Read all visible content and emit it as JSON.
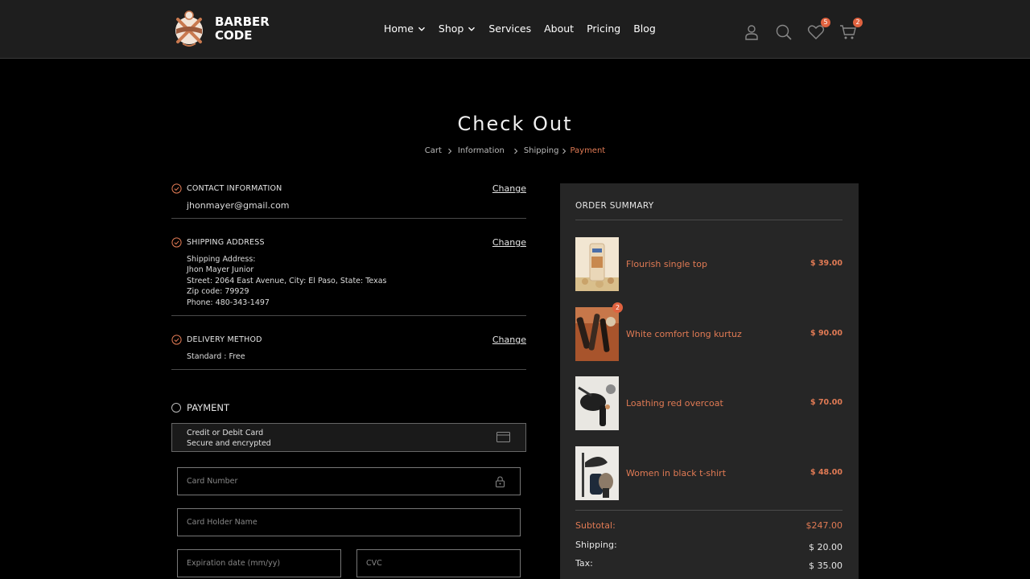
{
  "brand": {
    "line1": "BARBER",
    "line2": "CODE"
  },
  "nav": [
    {
      "label": "Home",
      "dropdown": true
    },
    {
      "label": "Shop",
      "dropdown": true
    },
    {
      "label": "Services",
      "dropdown": false
    },
    {
      "label": "About",
      "dropdown": false
    },
    {
      "label": "Pricing",
      "dropdown": false
    },
    {
      "label": "Blog",
      "dropdown": false
    }
  ],
  "header_icons": {
    "account": "user-icon",
    "search": "search-icon",
    "wishlist": "heart-icon",
    "wishlist_count": "5",
    "cart": "cart-icon",
    "cart_count": "2"
  },
  "page": {
    "title": "Check Out",
    "breadcrumb": [
      "Cart",
      "Information",
      "Shipping",
      "Payment"
    ],
    "breadcrumb_active": "Payment"
  },
  "contact": {
    "title": "CONTACT INFORMATION",
    "change": "Change",
    "email": "jhonmayer@gmail.com"
  },
  "shipping": {
    "title": "SHIPPING ADDRESS",
    "change": "Change",
    "lines": [
      "Shipping Address:",
      "Jhon Mayer Junior",
      "Street: 2064 East Avenue, City: El Paso, State: Texas",
      "Zip code: 79929",
      "Phone: 480-343-1497"
    ]
  },
  "delivery": {
    "title": "DELIVERY METHOD",
    "change": "Change",
    "method": "Standard : Free"
  },
  "payment": {
    "title": "PAYMENT",
    "option_line1": "Credit or Debit Card",
    "option_line2": "Secure and encrypted",
    "card_number_placeholder": "Card Number",
    "holder_placeholder": "Card Holder Name",
    "expiry_placeholder": "Expiration date (mm/yy)",
    "cvc_placeholder": "CVC"
  },
  "summary": {
    "title": "ORDER SUMMARY",
    "items": [
      {
        "name": "Flourish single top",
        "price": "$ 39.00",
        "qty_badge": ""
      },
      {
        "name": "White comfort long kurtuz",
        "price": "$ 90.00",
        "qty_badge": "2"
      },
      {
        "name": "Loathing red overcoat",
        "price": "$ 70.00",
        "qty_badge": ""
      },
      {
        "name": "Women in black t-shirt",
        "price": "$ 48.00",
        "qty_badge": ""
      }
    ],
    "subtotal_label": "Subtotal:",
    "subtotal_value": "$247.00",
    "shipping_label": "Shipping:",
    "shipping_value": "$ 20.00",
    "tax_label": "Tax:",
    "tax_value": "$ 35.00"
  },
  "colors": {
    "accent": "#e07a54",
    "badge": "#e0623f",
    "header_bg": "#1e1e1e",
    "panel_bg": "#262626",
    "page_bg": "#000000"
  }
}
